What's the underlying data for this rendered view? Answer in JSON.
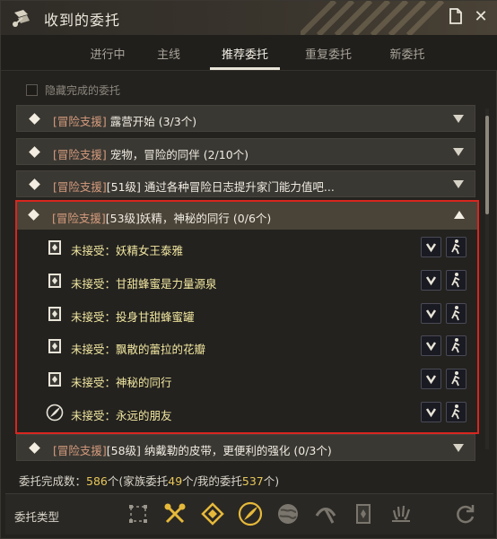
{
  "window": {
    "title": "收到的委托"
  },
  "tabs": [
    {
      "label": "进行中"
    },
    {
      "label": "主线"
    },
    {
      "label": "推荐委托"
    },
    {
      "label": "重复委托"
    },
    {
      "label": "新委托"
    }
  ],
  "active_tab": "推荐委托",
  "hide_completed": {
    "label": "隐藏完成的委托",
    "checked": false
  },
  "quests": [
    {
      "tag": "[冒险支援]",
      "title": " 露营开始 (3/3个)"
    },
    {
      "tag": "[冒险支援]",
      "title": " 宠物，冒险的同伴 (2/10个)"
    },
    {
      "tag": "[冒险支援]",
      "title": "[51级] 通过各种冒险日志提升家门能力值吧..."
    }
  ],
  "expanded_quest": {
    "tag": "[冒险支援]",
    "title": "[53级]妖精，神秘的同行 (0/6个)",
    "subquests": [
      {
        "status": "未接受：",
        "name": "妖精女王泰雅",
        "icon": "quest-book-icon"
      },
      {
        "status": "未接受：",
        "name": "甘甜蜂蜜是力量源泉",
        "icon": "quest-book-icon"
      },
      {
        "status": "未接受：",
        "name": "投身甘甜蜂蜜罐",
        "icon": "quest-book-icon"
      },
      {
        "status": "未接受：",
        "name": "飘散的蕾拉的花瓣",
        "icon": "quest-book-icon"
      },
      {
        "status": "未接受：",
        "name": "神秘的同行",
        "icon": "quest-book-icon"
      },
      {
        "status": "未接受：",
        "name": "永远的朋友",
        "icon": "feather-emblem-icon"
      }
    ]
  },
  "last_quest": {
    "tag": "[冒险支援]",
    "title": "[58级] 纳戴勒的皮带，更便利的强化 (0/3个)"
  },
  "completion": {
    "prefix": "委托完成数：",
    "total": "586",
    "mid1": "个(家族委托",
    "family": "49",
    "mid2": "个/我的委托",
    "mine": "537",
    "suffix": "个)"
  },
  "type_bar": {
    "label": "委托类型",
    "icons": [
      "dotted-square-icon",
      "crossed-tools-icon",
      "diamond-target-icon",
      "feather-emblem-icon",
      "globe-icon",
      "pickaxe-icon",
      "quest-book-icon",
      "splash-icon",
      "refresh-icon"
    ]
  },
  "colors": {
    "highlight_border": "#d8261f",
    "subquest_text": "#f2e7a0",
    "tag_text": "#d69c7e",
    "count_number": "#e8c75a"
  }
}
